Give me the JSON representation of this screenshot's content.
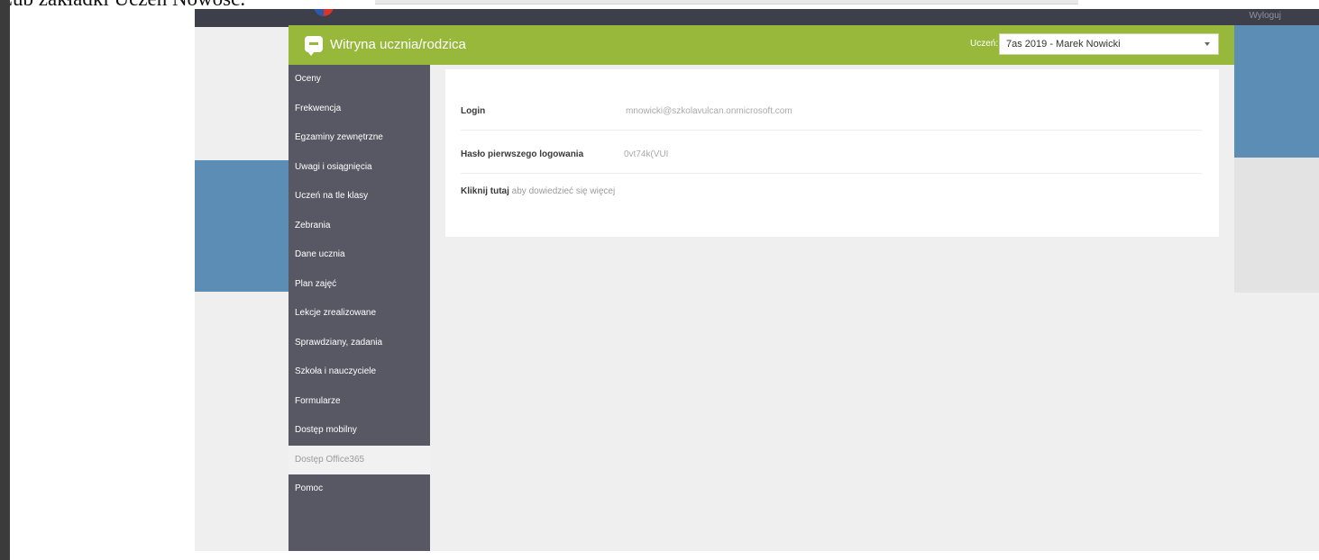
{
  "caption": "Lub zakładki Uczeń Nowość.",
  "app": {
    "corner_text": "Wyloguj",
    "title": "Witryna ucznia/rodzica",
    "student_label": "Uczeń:",
    "student_selected": "7as 2019 - Marek Nowicki"
  },
  "sidebar": {
    "items": [
      {
        "label": "Oceny"
      },
      {
        "label": "Frekwencja"
      },
      {
        "label": "Egzaminy zewnętrzne"
      },
      {
        "label": "Uwagi i osiągnięcia"
      },
      {
        "label": "Uczeń na tle klasy"
      },
      {
        "label": "Zebrania"
      },
      {
        "label": "Dane ucznia"
      },
      {
        "label": "Plan zajęć"
      },
      {
        "label": "Lekcje zrealizowane"
      },
      {
        "label": "Sprawdziany, zadania"
      },
      {
        "label": "Szkoła i nauczyciele"
      },
      {
        "label": "Formularze"
      },
      {
        "label": "Dostęp mobilny"
      },
      {
        "label": "Dostęp Office365",
        "active": true
      },
      {
        "label": "Pomoc"
      }
    ]
  },
  "content": {
    "login_label": "Login",
    "login_value": "mnowicki@szkolavulcan.onmicrosoft.com",
    "password_label": "Hasło pierwszego logowania",
    "password_value": "0vt74k(VUI",
    "more_bold": "Kliknij tutaj",
    "more_text": " aby dowiedzieć się więcej"
  },
  "colors": {
    "header_green": "#97b83b",
    "sidebar_bg": "#585864",
    "accent_blue": "#5b8db5",
    "top_bar": "#3d3f4b"
  }
}
